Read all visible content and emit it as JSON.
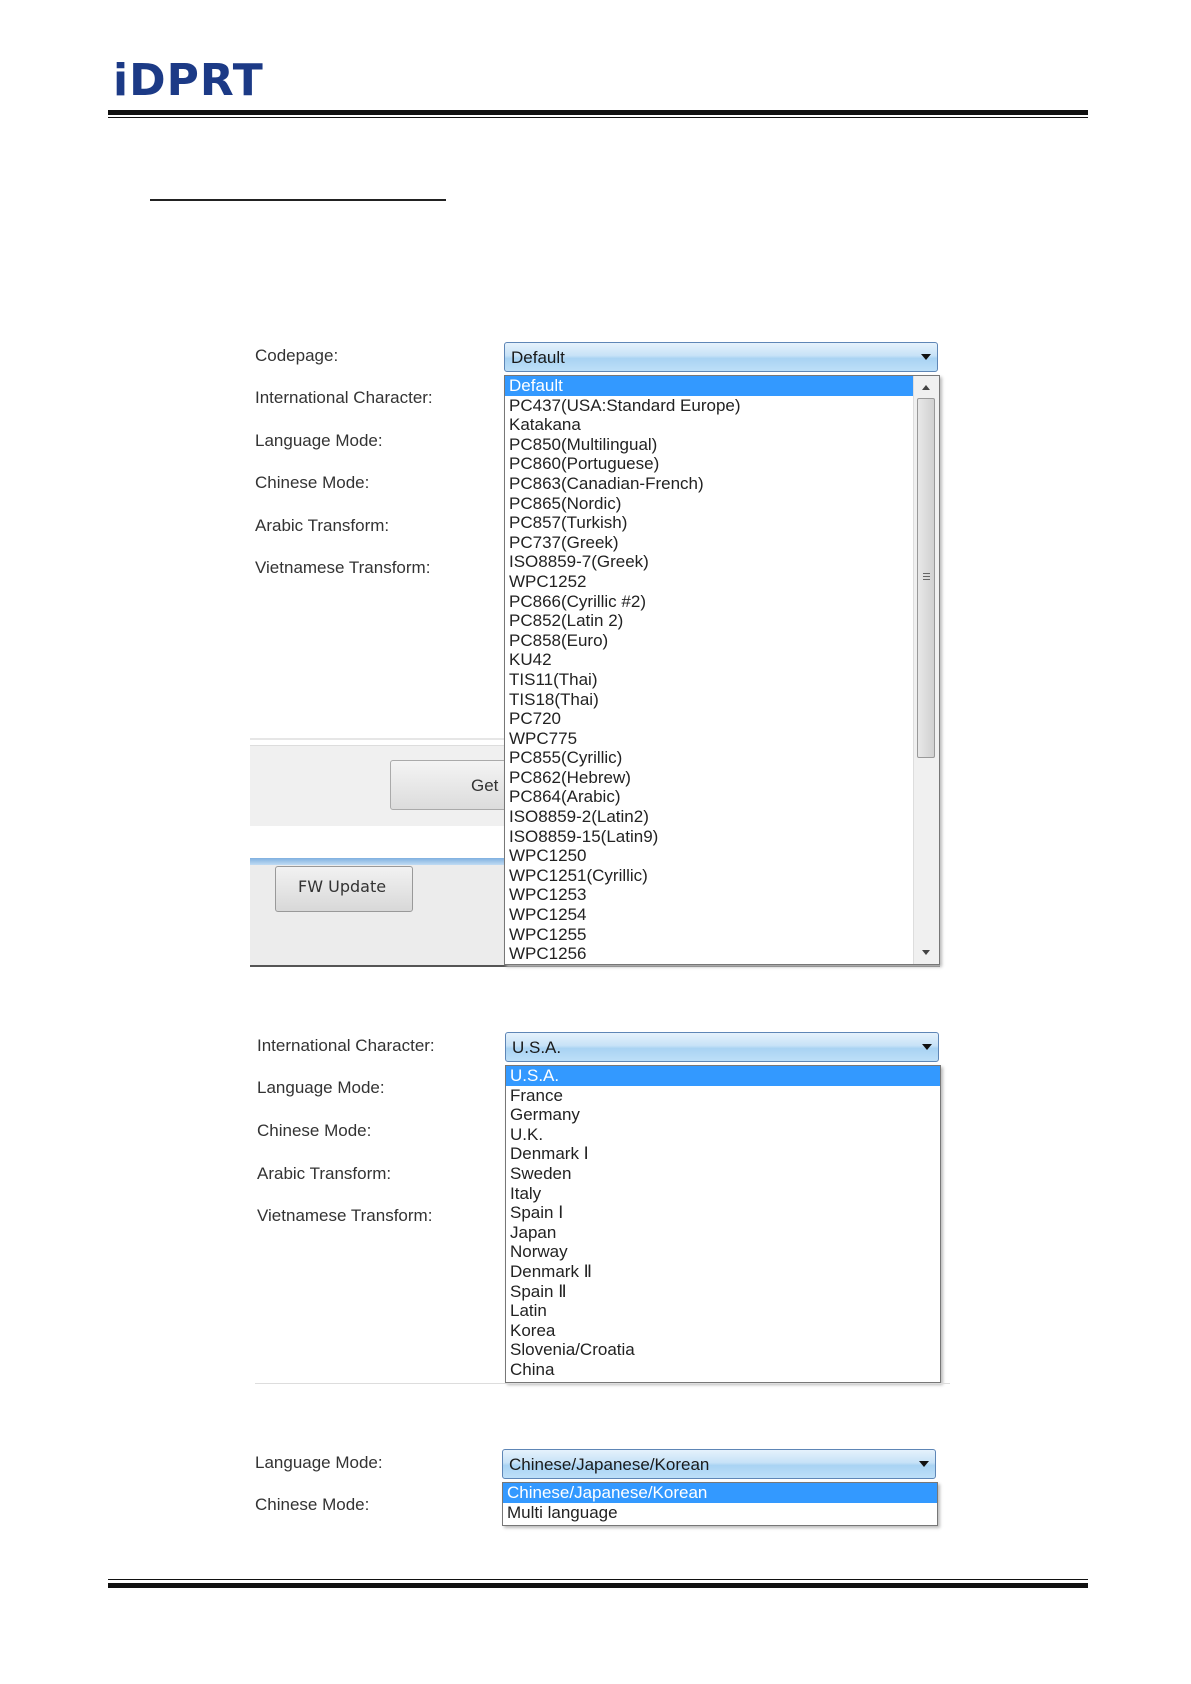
{
  "header": {
    "logo": "iDPRT"
  },
  "panel1": {
    "labels": [
      "Codepage:",
      "International Character:",
      "Language Mode:",
      "Chinese Mode:",
      "Arabic Transform:",
      "Vietnamese Transform:"
    ],
    "combo_value": "Default",
    "options": [
      "Default",
      "PC437(USA:Standard Europe)",
      "Katakana",
      "PC850(Multilingual)",
      "PC860(Portuguese)",
      "PC863(Canadian-French)",
      "PC865(Nordic)",
      "PC857(Turkish)",
      "PC737(Greek)",
      "ISO8859-7(Greek)",
      "WPC1252",
      "PC866(Cyrillic #2)",
      "PC852(Latin 2)",
      "PC858(Euro)",
      "KU42",
      "TIS11(Thai)",
      "TIS18(Thai)",
      "PC720",
      "WPC775",
      "PC855(Cyrillic)",
      "PC862(Hebrew)",
      "PC864(Arabic)",
      "ISO8859-2(Latin2)",
      "ISO8859-15(Latin9)",
      "WPC1250",
      "WPC1251(Cyrillic)",
      "WPC1253",
      "WPC1254",
      "WPC1255",
      "WPC1256"
    ],
    "selected_index": 0,
    "get_button": "Get",
    "fw_update_button": "FW Update"
  },
  "panel2": {
    "labels": [
      "International Character:",
      "Language Mode:",
      "Chinese Mode:",
      "Arabic Transform:",
      "Vietnamese Transform:"
    ],
    "combo_value": "U.S.A.",
    "options": [
      "U.S.A.",
      "France",
      "Germany",
      "U.K.",
      "Denmark Ⅰ",
      "Sweden",
      "Italy",
      "Spain Ⅰ",
      "Japan",
      "Norway",
      "Denmark Ⅱ",
      "Spain Ⅱ",
      "Latin",
      "Korea",
      "Slovenia/Croatia",
      "China"
    ],
    "selected_index": 0
  },
  "panel3": {
    "labels": [
      "Language Mode:",
      "Chinese Mode:"
    ],
    "combo_value": "Chinese/Japanese/Korean",
    "options": [
      "Chinese/Japanese/Korean",
      "Multi language"
    ],
    "selected_index": 0
  }
}
